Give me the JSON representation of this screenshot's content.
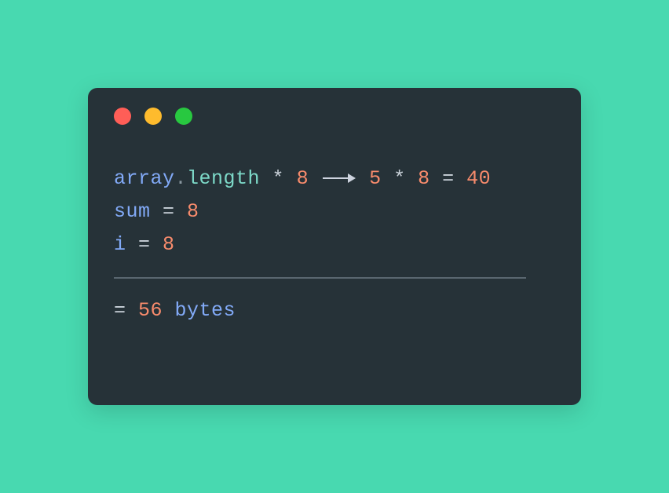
{
  "line1": {
    "var1": "array",
    "dot": ".",
    "prop": "length",
    "times1": " * ",
    "eight1": "8",
    "five": "5",
    "times2": " * ",
    "eight2": "8",
    "eq1": " = ",
    "forty": "40"
  },
  "line2": {
    "var": "sum",
    "eq": " = ",
    "val": "8"
  },
  "line3": {
    "var": "i",
    "eq": " = ",
    "val": "8"
  },
  "line4": {
    "eq": "= ",
    "val": "56",
    "unit": " bytes"
  }
}
